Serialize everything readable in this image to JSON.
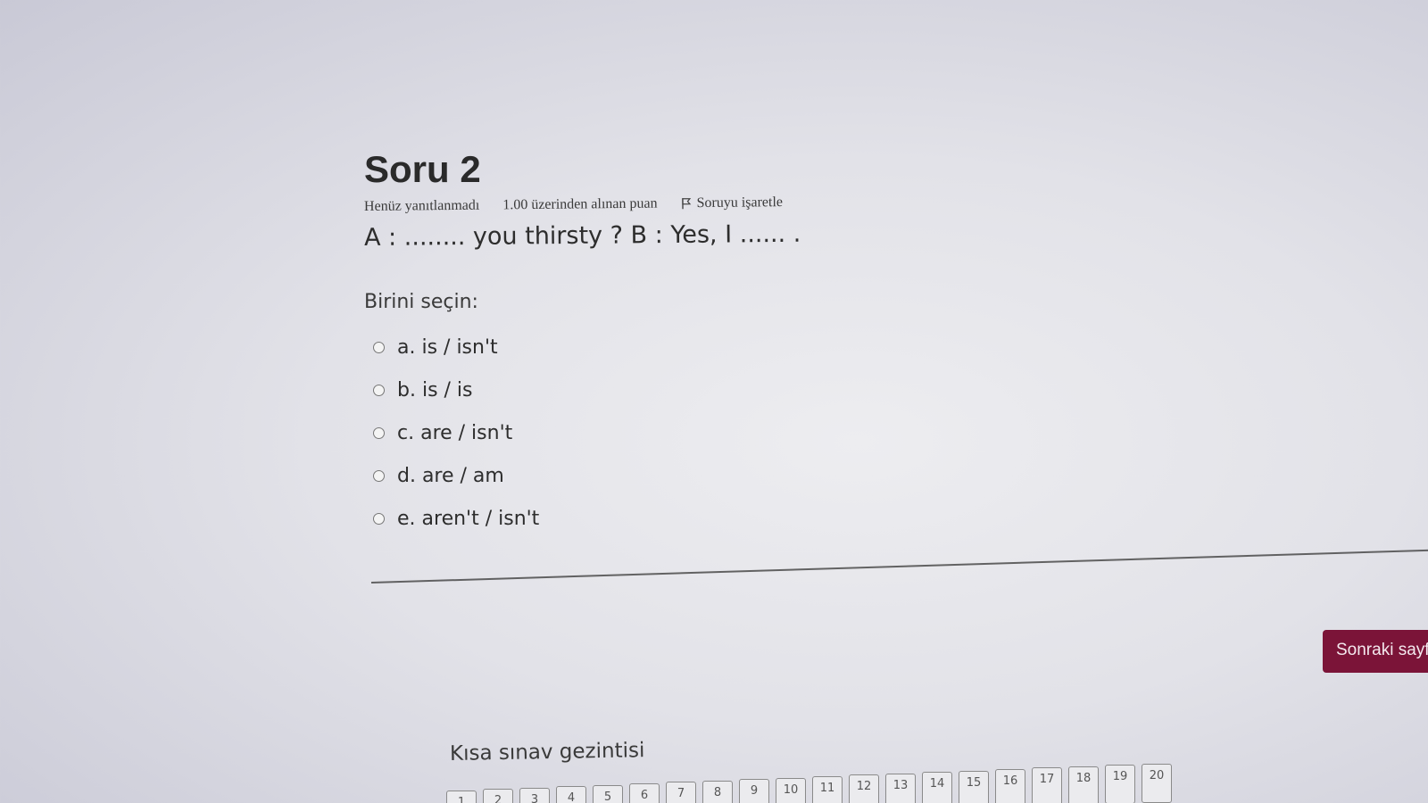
{
  "quiz": {
    "question_title": "Soru 2",
    "status": "Henüz yanıtlanmadı",
    "grade_info": "1.00 üzerinden alınan puan",
    "flag_label": "Soruyu işaretle",
    "question_text": "A : ........ you thirsty ? B : Yes, I ...... .",
    "prompt": "Birini seçin:",
    "options": [
      "a. is / isn't",
      "b. is / is",
      "c. are / isn't",
      "d. are / am",
      "e. aren't / isn't"
    ],
    "next_label": "Sonraki sayfa"
  },
  "navigation": {
    "title": "Kısa sınav gezintisi",
    "buttons": [
      "1",
      "2",
      "3",
      "4",
      "5",
      "6",
      "7",
      "8",
      "9",
      "10",
      "11",
      "12",
      "13",
      "14",
      "15",
      "16",
      "17",
      "18",
      "19",
      "20"
    ]
  },
  "icons": {
    "flag": "flag-icon",
    "radio": "radio-circle-icon"
  },
  "colors": {
    "next_button": "#7b1438",
    "background": "#e2e2e8"
  }
}
